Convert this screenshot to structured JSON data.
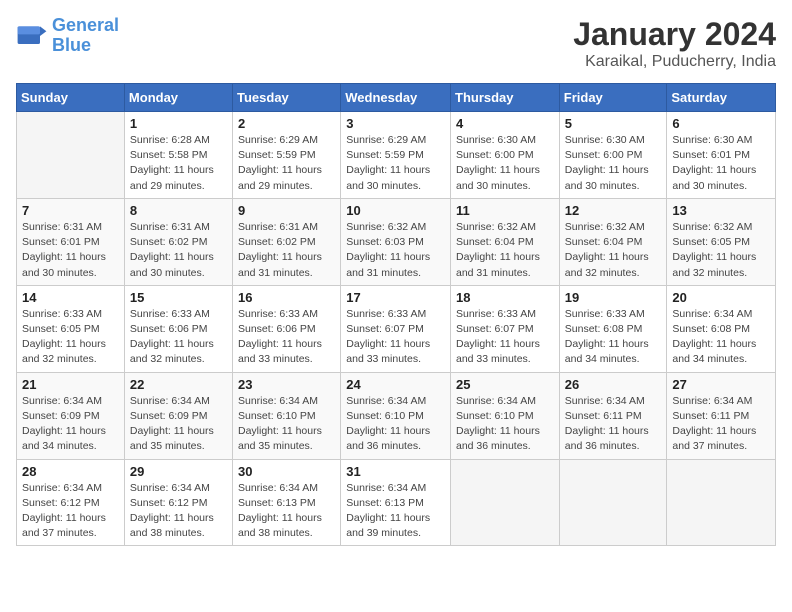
{
  "header": {
    "logo_line1": "General",
    "logo_line2": "Blue",
    "month_year": "January 2024",
    "location": "Karaikal, Puducherry, India"
  },
  "columns": [
    "Sunday",
    "Monday",
    "Tuesday",
    "Wednesday",
    "Thursday",
    "Friday",
    "Saturday"
  ],
  "weeks": [
    [
      {
        "day": "",
        "detail": ""
      },
      {
        "day": "1",
        "detail": "Sunrise: 6:28 AM\nSunset: 5:58 PM\nDaylight: 11 hours\nand 29 minutes."
      },
      {
        "day": "2",
        "detail": "Sunrise: 6:29 AM\nSunset: 5:59 PM\nDaylight: 11 hours\nand 29 minutes."
      },
      {
        "day": "3",
        "detail": "Sunrise: 6:29 AM\nSunset: 5:59 PM\nDaylight: 11 hours\nand 30 minutes."
      },
      {
        "day": "4",
        "detail": "Sunrise: 6:30 AM\nSunset: 6:00 PM\nDaylight: 11 hours\nand 30 minutes."
      },
      {
        "day": "5",
        "detail": "Sunrise: 6:30 AM\nSunset: 6:00 PM\nDaylight: 11 hours\nand 30 minutes."
      },
      {
        "day": "6",
        "detail": "Sunrise: 6:30 AM\nSunset: 6:01 PM\nDaylight: 11 hours\nand 30 minutes."
      }
    ],
    [
      {
        "day": "7",
        "detail": "Sunrise: 6:31 AM\nSunset: 6:01 PM\nDaylight: 11 hours\nand 30 minutes."
      },
      {
        "day": "8",
        "detail": "Sunrise: 6:31 AM\nSunset: 6:02 PM\nDaylight: 11 hours\nand 30 minutes."
      },
      {
        "day": "9",
        "detail": "Sunrise: 6:31 AM\nSunset: 6:02 PM\nDaylight: 11 hours\nand 31 minutes."
      },
      {
        "day": "10",
        "detail": "Sunrise: 6:32 AM\nSunset: 6:03 PM\nDaylight: 11 hours\nand 31 minutes."
      },
      {
        "day": "11",
        "detail": "Sunrise: 6:32 AM\nSunset: 6:04 PM\nDaylight: 11 hours\nand 31 minutes."
      },
      {
        "day": "12",
        "detail": "Sunrise: 6:32 AM\nSunset: 6:04 PM\nDaylight: 11 hours\nand 32 minutes."
      },
      {
        "day": "13",
        "detail": "Sunrise: 6:32 AM\nSunset: 6:05 PM\nDaylight: 11 hours\nand 32 minutes."
      }
    ],
    [
      {
        "day": "14",
        "detail": "Sunrise: 6:33 AM\nSunset: 6:05 PM\nDaylight: 11 hours\nand 32 minutes."
      },
      {
        "day": "15",
        "detail": "Sunrise: 6:33 AM\nSunset: 6:06 PM\nDaylight: 11 hours\nand 32 minutes."
      },
      {
        "day": "16",
        "detail": "Sunrise: 6:33 AM\nSunset: 6:06 PM\nDaylight: 11 hours\nand 33 minutes."
      },
      {
        "day": "17",
        "detail": "Sunrise: 6:33 AM\nSunset: 6:07 PM\nDaylight: 11 hours\nand 33 minutes."
      },
      {
        "day": "18",
        "detail": "Sunrise: 6:33 AM\nSunset: 6:07 PM\nDaylight: 11 hours\nand 33 minutes."
      },
      {
        "day": "19",
        "detail": "Sunrise: 6:33 AM\nSunset: 6:08 PM\nDaylight: 11 hours\nand 34 minutes."
      },
      {
        "day": "20",
        "detail": "Sunrise: 6:34 AM\nSunset: 6:08 PM\nDaylight: 11 hours\nand 34 minutes."
      }
    ],
    [
      {
        "day": "21",
        "detail": "Sunrise: 6:34 AM\nSunset: 6:09 PM\nDaylight: 11 hours\nand 34 minutes."
      },
      {
        "day": "22",
        "detail": "Sunrise: 6:34 AM\nSunset: 6:09 PM\nDaylight: 11 hours\nand 35 minutes."
      },
      {
        "day": "23",
        "detail": "Sunrise: 6:34 AM\nSunset: 6:10 PM\nDaylight: 11 hours\nand 35 minutes."
      },
      {
        "day": "24",
        "detail": "Sunrise: 6:34 AM\nSunset: 6:10 PM\nDaylight: 11 hours\nand 36 minutes."
      },
      {
        "day": "25",
        "detail": "Sunrise: 6:34 AM\nSunset: 6:10 PM\nDaylight: 11 hours\nand 36 minutes."
      },
      {
        "day": "26",
        "detail": "Sunrise: 6:34 AM\nSunset: 6:11 PM\nDaylight: 11 hours\nand 36 minutes."
      },
      {
        "day": "27",
        "detail": "Sunrise: 6:34 AM\nSunset: 6:11 PM\nDaylight: 11 hours\nand 37 minutes."
      }
    ],
    [
      {
        "day": "28",
        "detail": "Sunrise: 6:34 AM\nSunset: 6:12 PM\nDaylight: 11 hours\nand 37 minutes."
      },
      {
        "day": "29",
        "detail": "Sunrise: 6:34 AM\nSunset: 6:12 PM\nDaylight: 11 hours\nand 38 minutes."
      },
      {
        "day": "30",
        "detail": "Sunrise: 6:34 AM\nSunset: 6:13 PM\nDaylight: 11 hours\nand 38 minutes."
      },
      {
        "day": "31",
        "detail": "Sunrise: 6:34 AM\nSunset: 6:13 PM\nDaylight: 11 hours\nand 39 minutes."
      },
      {
        "day": "",
        "detail": ""
      },
      {
        "day": "",
        "detail": ""
      },
      {
        "day": "",
        "detail": ""
      }
    ]
  ]
}
